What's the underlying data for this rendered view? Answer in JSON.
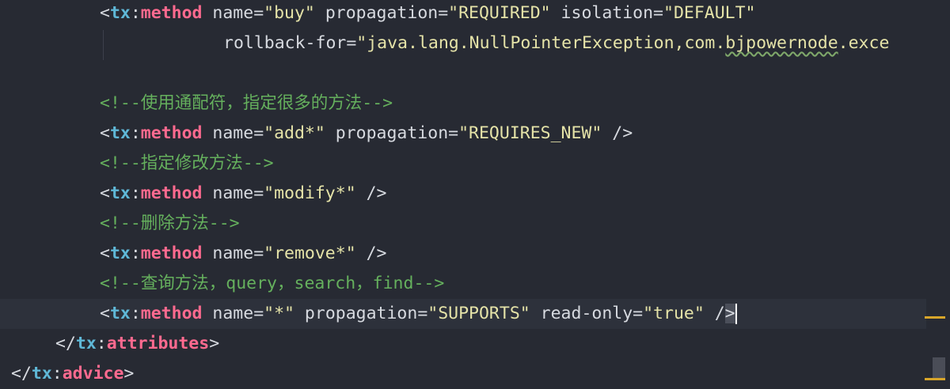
{
  "editor": {
    "lines": [
      {
        "parts": [
          [
            "punct",
            "<"
          ],
          [
            "ns",
            "tx"
          ],
          [
            "punct",
            ":"
          ],
          [
            "tag",
            "method"
          ],
          [
            "attr",
            " name="
          ],
          [
            "val",
            "\"buy\""
          ],
          [
            "attr",
            " propagation="
          ],
          [
            "val",
            "\"REQUIRED\""
          ],
          [
            "attr",
            " isolation="
          ],
          [
            "val",
            "\"DEFAULT\""
          ]
        ]
      },
      {
        "parts": [
          [
            "attr",
            "rollback-for="
          ],
          [
            "val",
            "\"java.lang.NullPointerException,com."
          ],
          [
            "valsq",
            "bjpowernode"
          ],
          [
            "val",
            ".exce"
          ]
        ]
      },
      {
        "parts": []
      },
      {
        "parts": [
          [
            "comment",
            "<!--使用通配符，指定很多的方法-->"
          ]
        ]
      },
      {
        "parts": [
          [
            "punct",
            "<"
          ],
          [
            "ns",
            "tx"
          ],
          [
            "punct",
            ":"
          ],
          [
            "tag",
            "method"
          ],
          [
            "attr",
            " name="
          ],
          [
            "val",
            "\"add*\""
          ],
          [
            "attr",
            " propagation="
          ],
          [
            "val",
            "\"REQUIRES_NEW\""
          ],
          [
            "punct",
            " />"
          ]
        ]
      },
      {
        "parts": [
          [
            "comment",
            "<!--指定修改方法-->"
          ]
        ]
      },
      {
        "parts": [
          [
            "punct",
            "<"
          ],
          [
            "ns",
            "tx"
          ],
          [
            "punct",
            ":"
          ],
          [
            "tag",
            "method"
          ],
          [
            "attr",
            " name="
          ],
          [
            "val",
            "\"modify*\""
          ],
          [
            "punct",
            " />"
          ]
        ]
      },
      {
        "parts": [
          [
            "comment",
            "<!--删除方法-->"
          ]
        ]
      },
      {
        "parts": [
          [
            "punct",
            "<"
          ],
          [
            "ns",
            "tx"
          ],
          [
            "punct",
            ":"
          ],
          [
            "tag",
            "method"
          ],
          [
            "attr",
            " name="
          ],
          [
            "val",
            "\"remove*\""
          ],
          [
            "punct",
            " />"
          ]
        ]
      },
      {
        "parts": [
          [
            "comment",
            "<!--查询方法，query，search，find-->"
          ]
        ]
      },
      {
        "parts": [
          [
            "punct",
            "<"
          ],
          [
            "ns",
            "tx"
          ],
          [
            "punct",
            ":"
          ],
          [
            "tag",
            "method"
          ],
          [
            "attr",
            " name="
          ],
          [
            "val",
            "\"*\""
          ],
          [
            "attr",
            " propagation="
          ],
          [
            "val",
            "\"SUPPORTS\""
          ],
          [
            "attr",
            " read-only="
          ],
          [
            "val",
            "\"true\""
          ],
          [
            "punct",
            " /"
          ],
          [
            "brhl",
            ">"
          ],
          [
            "caret",
            ""
          ]
        ]
      },
      {
        "parts": [
          [
            "punct",
            "</"
          ],
          [
            "ns",
            "tx"
          ],
          [
            "punct",
            ":"
          ],
          [
            "tag",
            "attributes"
          ],
          [
            "punct",
            ">"
          ]
        ]
      },
      {
        "parts": [
          [
            "punct",
            "</"
          ],
          [
            "ns",
            "tx"
          ],
          [
            "punct",
            ":"
          ],
          [
            "tag",
            "advice"
          ],
          [
            "punct",
            ">"
          ]
        ]
      }
    ]
  },
  "colors": {
    "background": "#272a33",
    "current_line": "#2d313b",
    "tag_name": "#ff6a8f",
    "namespace": "#5fb7d6",
    "attribute_value": "#e5e3a8",
    "comment": "#65b05d",
    "marker": "#d7a52a"
  }
}
